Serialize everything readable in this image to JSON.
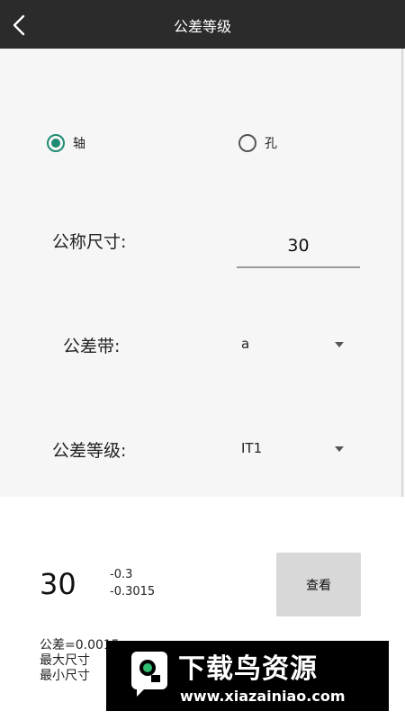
{
  "header": {
    "title": "公差等级"
  },
  "form": {
    "radio_shaft": "轴",
    "radio_hole": "孔",
    "selected": "shaft",
    "size_label": "公称尺寸:",
    "size_value": "30",
    "band_label": "公差带:",
    "band_value": "a",
    "grade_label": "公差等级:",
    "grade_value": "IT1"
  },
  "result": {
    "size": "30",
    "upper_dev": "-0.3",
    "lower_dev": "-0.3015",
    "view_button": "查看",
    "tolerance": "公差=0.0015",
    "max_size": "最大尺寸",
    "min_size": "最小尺寸"
  },
  "watermark": {
    "title": "下载鸟资源",
    "url": "www.xiazainiao.com"
  },
  "colors": {
    "accent": "#1e8c74",
    "topbar": "#2b2b2b",
    "panel": "#f6f6f6",
    "button": "#d8d8d8"
  }
}
